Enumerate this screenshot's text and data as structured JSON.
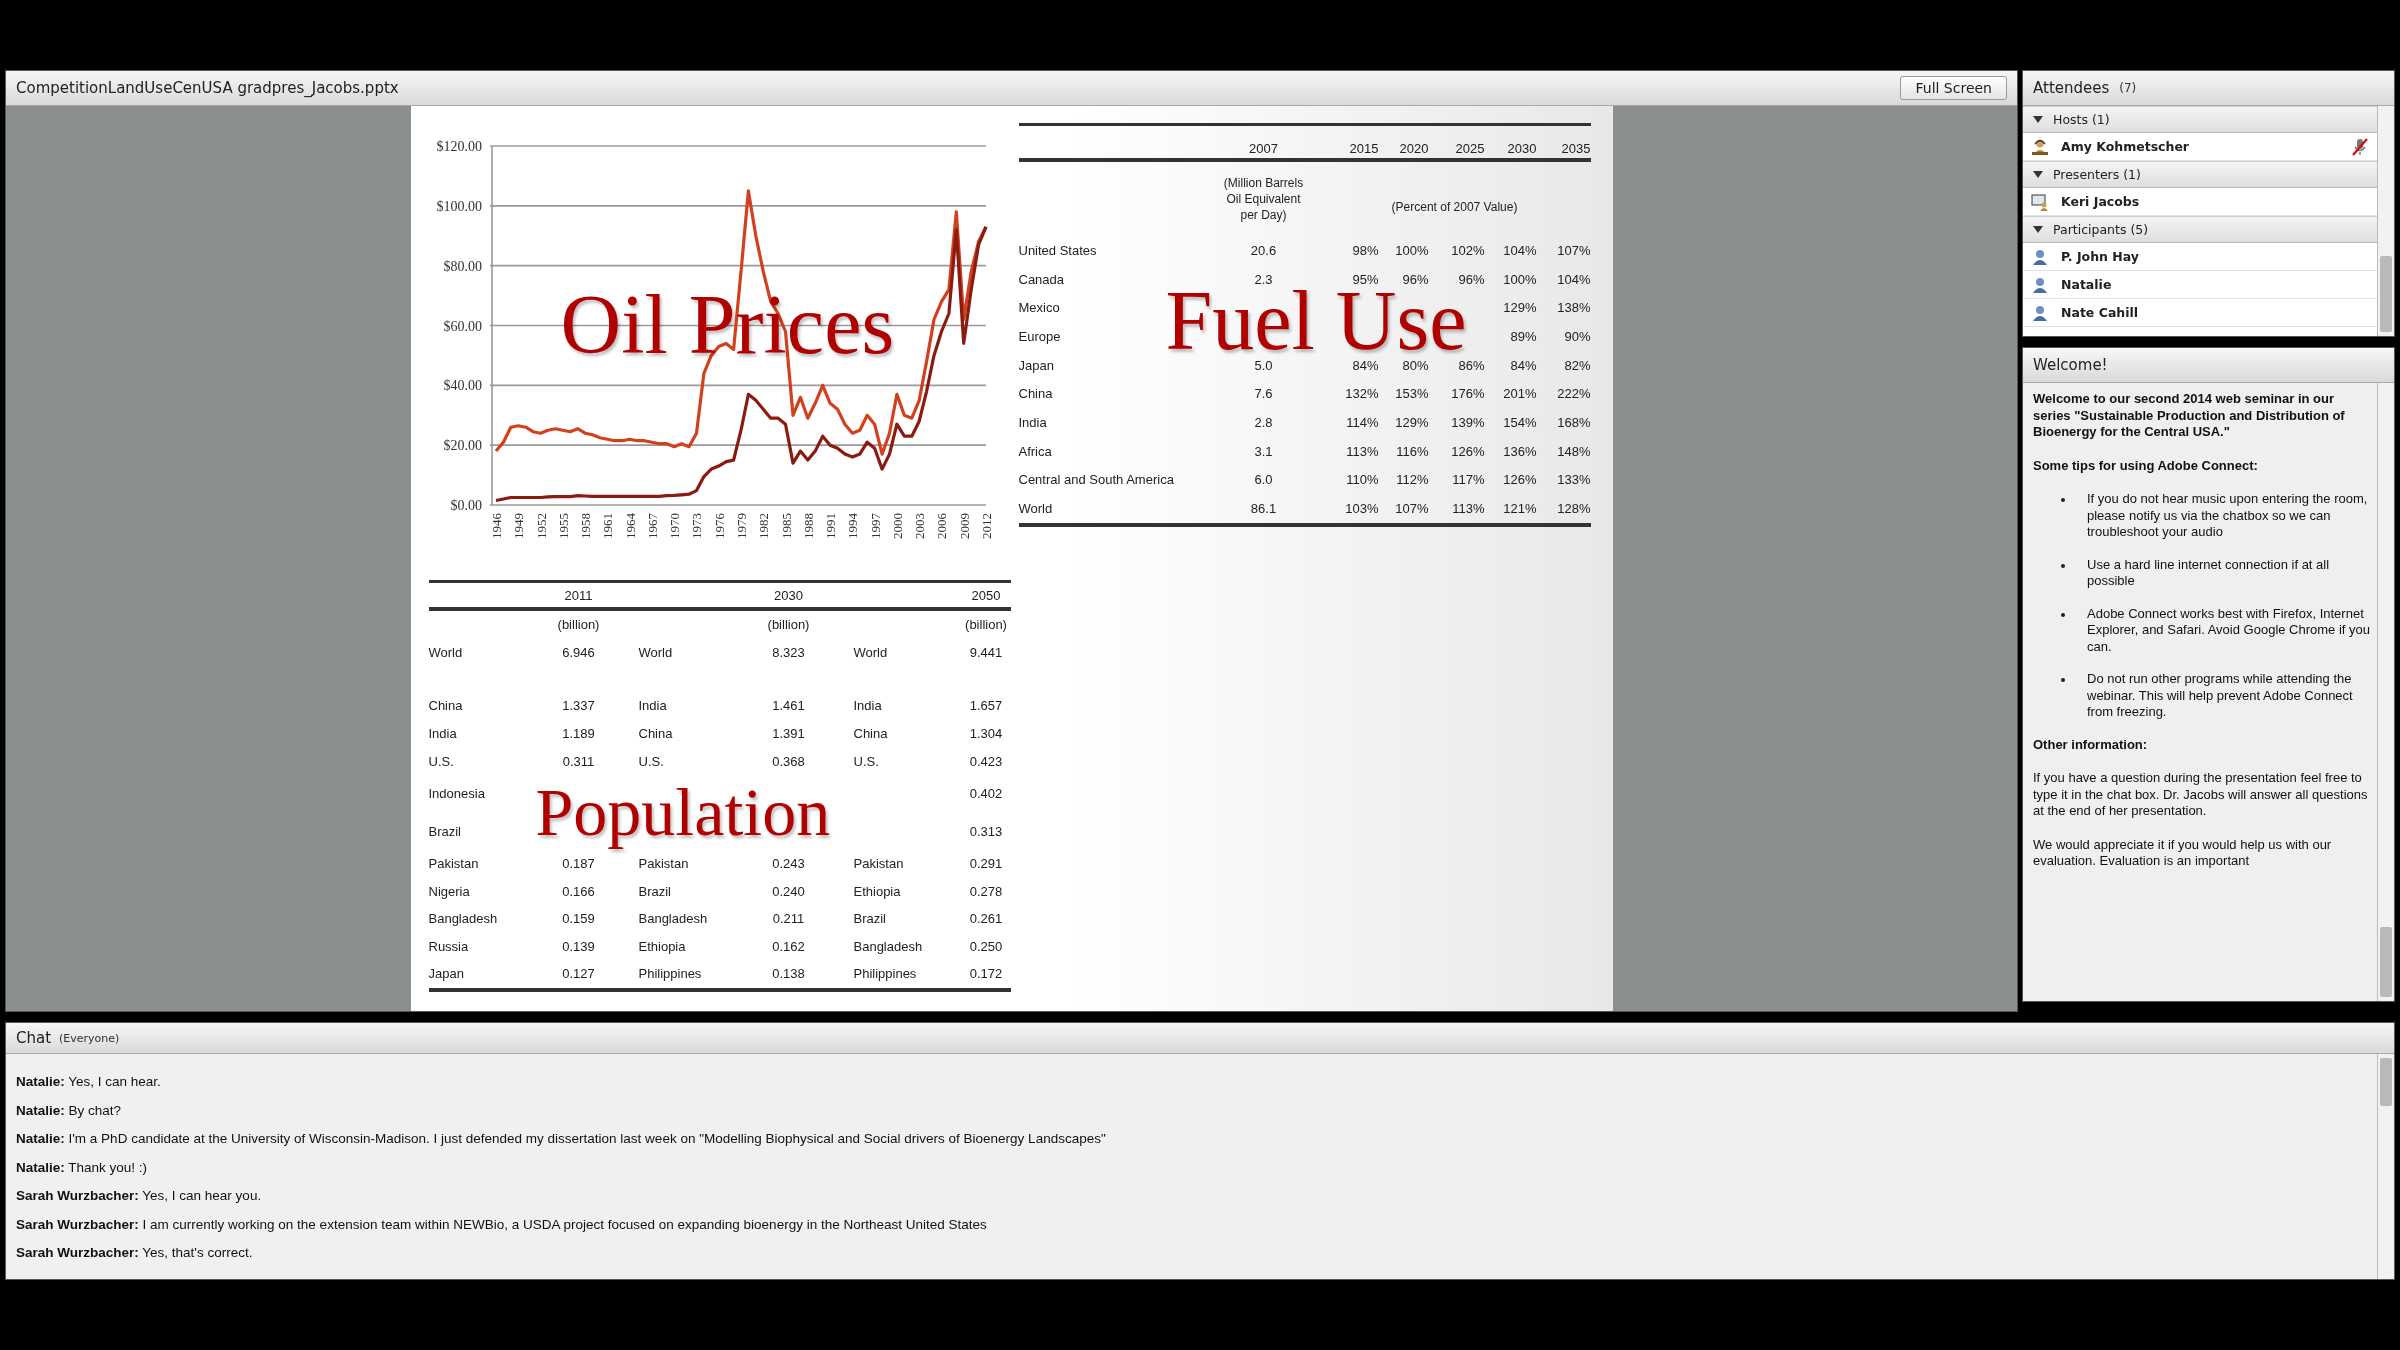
{
  "share_pod": {
    "title": "CompetitionLandUseCenUSA gradpres_Jacobs.pptx",
    "full_screen_button": "Full Screen"
  },
  "slide": {
    "oil_chart": {
      "overlay_title": "Oil Prices",
      "chart_data": {
        "type": "line",
        "x": [
          1946,
          1947,
          1948,
          1949,
          1950,
          1951,
          1952,
          1953,
          1954,
          1955,
          1956,
          1957,
          1958,
          1959,
          1960,
          1961,
          1962,
          1963,
          1964,
          1965,
          1966,
          1967,
          1968,
          1969,
          1970,
          1971,
          1972,
          1973,
          1974,
          1975,
          1976,
          1977,
          1978,
          1979,
          1980,
          1981,
          1982,
          1983,
          1984,
          1985,
          1986,
          1987,
          1988,
          1989,
          1990,
          1991,
          1992,
          1993,
          1994,
          1995,
          1996,
          1997,
          1998,
          1999,
          2000,
          2001,
          2002,
          2003,
          2004,
          2005,
          2006,
          2007,
          2008,
          2009,
          2010,
          2011,
          2012
        ],
        "series": [
          {
            "color": "#d2401e",
            "values": [
              18,
              21,
              26,
              26.5,
              26,
              24.5,
              24,
              25,
              25.5,
              25,
              24.5,
              25.5,
              24,
              23.5,
              22.5,
              22,
              21.5,
              21.5,
              22,
              21.5,
              21.5,
              21,
              20.5,
              20.5,
              19.5,
              20.5,
              19.5,
              24,
              44,
              50,
              53,
              54,
              52,
              78,
              105,
              90,
              78,
              68,
              64,
              58,
              30,
              36,
              29,
              34,
              40,
              34,
              32,
              27,
              24,
              25,
              30,
              27,
              17,
              24,
              37,
              30,
              29,
              35,
              48,
              62,
              68,
              72,
              98,
              62,
              78,
              88,
              93
            ]
          },
          {
            "color": "#8b1a10",
            "values": [
              1.5,
              2,
              2.5,
              2.5,
              2.5,
              2.5,
              2.5,
              2.7,
              2.8,
              2.8,
              2.8,
              3.1,
              3,
              2.9,
              2.9,
              2.9,
              2.9,
              2.9,
              2.9,
              2.9,
              2.9,
              2.9,
              2.9,
              3.1,
              3.2,
              3.4,
              3.6,
              4.8,
              9.5,
              12,
              13,
              14.5,
              15,
              25,
              37,
              35,
              32,
              29,
              29,
              27,
              14,
              18,
              15,
              18,
              23,
              20,
              19,
              17,
              16,
              17,
              21,
              19,
              12,
              17,
              27,
              23,
              23,
              28,
              38,
              50,
              58,
              64,
              92,
              54,
              72,
              87,
              93
            ]
          }
        ],
        "xlim": [
          1946,
          2012
        ],
        "ylim": [
          0,
          120
        ],
        "grid": true,
        "xticks": [
          1946,
          1949,
          1952,
          1955,
          1958,
          1961,
          1964,
          1967,
          1970,
          1973,
          1976,
          1979,
          1982,
          1985,
          1988,
          1991,
          1994,
          1997,
          2000,
          2003,
          2006,
          2009,
          2012
        ],
        "yticks": [
          {
            "value": 0,
            "label": "$0.00"
          },
          {
            "value": 20,
            "label": "$20.00"
          },
          {
            "value": 40,
            "label": "$40.00"
          },
          {
            "value": 60,
            "label": "$60.00"
          },
          {
            "value": 80,
            "label": "$80.00"
          },
          {
            "value": 100,
            "label": "$100.00"
          },
          {
            "value": 120,
            "label": "$120.00"
          }
        ]
      }
    },
    "fuel_table": {
      "overlay_title": "Fuel Use",
      "years": [
        "2007",
        "2015",
        "2020",
        "2025",
        "2030",
        "2035"
      ],
      "base_unit": "(Million Barrels Oil Equivalent per Day)",
      "percent_unit": "(Percent of 2007 Value)",
      "rows": [
        {
          "region": "United States",
          "base": "20.6",
          "percents": [
            "98%",
            "100%",
            "102%",
            "104%",
            "107%"
          ]
        },
        {
          "region": "Canada",
          "base": "2.3",
          "percents": [
            "95%",
            "96%",
            "96%",
            "100%",
            "104%"
          ]
        },
        {
          "region": "Mexico",
          "percents": [
            "129%",
            "138%"
          ]
        },
        {
          "region": "Europe",
          "percents": [
            "89%",
            "90%"
          ]
        },
        {
          "region": "Japan",
          "base": "5.0",
          "percents": [
            "84%",
            "80%",
            "86%",
            "84%",
            "82%"
          ]
        },
        {
          "region": "China",
          "base": "7.6",
          "percents": [
            "132%",
            "153%",
            "176%",
            "201%",
            "222%"
          ]
        },
        {
          "region": "India",
          "base": "2.8",
          "percents": [
            "114%",
            "129%",
            "139%",
            "154%",
            "168%"
          ]
        },
        {
          "region": "Africa",
          "base": "3.1",
          "percents": [
            "113%",
            "116%",
            "126%",
            "136%",
            "148%"
          ]
        },
        {
          "region": "Central and South America",
          "base": "6.0",
          "percents": [
            "110%",
            "112%",
            "117%",
            "126%",
            "133%"
          ]
        },
        {
          "region": "World",
          "base": "86.1",
          "percents": [
            "103%",
            "107%",
            "113%",
            "121%",
            "128%"
          ]
        }
      ]
    },
    "population_table": {
      "overlay_title": "Population",
      "years": [
        "2011",
        "2030",
        "2050"
      ],
      "units": [
        "(billion)",
        "(billion)",
        "(billion)"
      ],
      "world_row": [
        "World",
        "6.946",
        "World",
        "8.323",
        "World",
        "9.441"
      ],
      "rows": [
        {
          "cells": [
            "China",
            "1.337",
            "India",
            "1.461",
            "India",
            "1.657"
          ]
        },
        {
          "cells": [
            "India",
            "1.189",
            "China",
            "1.391",
            "China",
            "1.304"
          ]
        },
        {
          "cells": [
            "U.S.",
            "0.311",
            "U.S.",
            "0.368",
            "U.S.",
            "0.423"
          ]
        },
        {
          "cells": [
            "Indonesia"
          ],
          "end_cells": [
            "0.402"
          ]
        },
        {
          "cells": [
            "Brazil"
          ],
          "end_cells": [
            "0.313"
          ]
        },
        {
          "cells": [
            "Pakistan",
            "0.187",
            "Pakistan",
            "0.243",
            "Pakistan",
            "0.291"
          ]
        },
        {
          "cells": [
            "Nigeria",
            "0.166",
            "Brazil",
            "0.240",
            "Ethiopia",
            "0.278"
          ]
        },
        {
          "cells": [
            "Bangladesh",
            "0.159",
            "Bangladesh",
            "0.211",
            "Brazil",
            "0.261"
          ]
        },
        {
          "cells": [
            "Russia",
            "0.139",
            "Ethiopia",
            "0.162",
            "Bangladesh",
            "0.250"
          ]
        },
        {
          "cells": [
            "Japan",
            "0.127",
            "Philippines",
            "0.138",
            "Philippines",
            "0.172"
          ]
        }
      ]
    }
  },
  "attendees": {
    "title": "Attendees",
    "count": "(7)",
    "groups": [
      {
        "label": "Hosts (1)",
        "expanded": true,
        "members": [
          {
            "name": "Amy Kohmetscher",
            "kind": "host",
            "mic_muted": true
          }
        ]
      },
      {
        "label": "Presenters (1)",
        "expanded": true,
        "members": [
          {
            "name": "Keri Jacobs",
            "kind": "presenter",
            "mic_muted": false
          }
        ]
      },
      {
        "label": "Participants (5)",
        "expanded": true,
        "members": [
          {
            "name": "P. John Hay",
            "kind": "participant",
            "mic_muted": false
          },
          {
            "name": "Natalie",
            "kind": "participant",
            "mic_muted": false
          },
          {
            "name": "Nate Cahill",
            "kind": "participant",
            "mic_muted": false
          }
        ]
      }
    ]
  },
  "welcome": {
    "title": "Welcome!",
    "paragraphs": [
      {
        "kind": "intro",
        "text": "Welcome to our second 2014 web seminar in our series \"Sustainable Production and Distribution of Bioenergy for the Central USA.\""
      },
      {
        "kind": "heading",
        "text": "Some tips for using Adobe Connect:"
      },
      {
        "kind": "bullet",
        "text": "If you do not hear music upon entering the room, please notify us via the chatbox so we can troubleshoot your audio"
      },
      {
        "kind": "bullet",
        "text": "Use a hard line internet connection if at all possible"
      },
      {
        "kind": "bullet",
        "text": "Adobe Connect works best with Firefox, Internet Explorer, and Safari. Avoid Google Chrome if you can."
      },
      {
        "kind": "bullet",
        "text": "Do not run other programs while attending the webinar. This will help prevent Adobe Connect from freezing."
      },
      {
        "kind": "heading",
        "text": "Other information:"
      },
      {
        "kind": "text",
        "text": "If you have a question during the presentation feel free to type it in the chat box. Dr. Jacobs will answer all questions at the end of her presentation."
      },
      {
        "kind": "text",
        "text": "We would appreciate it if you would help us with our evaluation. Evaluation is an important"
      }
    ]
  },
  "chat": {
    "title": "Chat",
    "audience": "(Everyone)",
    "messages": [
      "**Natalie:** Yes, I can hear.",
      "**Natalie:** By chat?",
      "**Natalie:** I'm a PhD candidate at the University of Wisconsin-Madison.  I just defended my dissertation last week on \"Modelling Biophysical and Social drivers of Bioenergy Landscapes\"",
      "**Natalie:** Thank you!  :)",
      "**Sarah Wurzbacher:** Yes, I can hear you.",
      "**Sarah Wurzbacher:** I am currently working on the extension team within NEWBio, a USDA project focused on expanding bioenergy in the Northeast United States",
      "**Sarah Wurzbacher:** Yes, that's correct."
    ]
  }
}
